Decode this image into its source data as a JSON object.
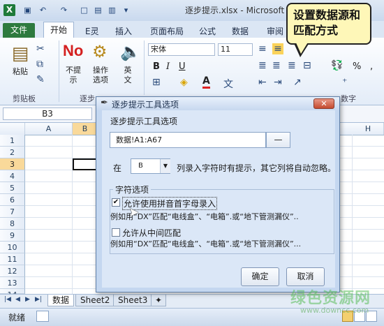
{
  "window": {
    "title": "逐步提示.xlsx - Microsoft Excel",
    "app_icon": "X"
  },
  "ribbon": {
    "tabs": [
      "文件",
      "开始",
      "E灵",
      "插入",
      "页面布局",
      "公式",
      "数据",
      "审阅"
    ],
    "clipboard": {
      "paste_label": "粘贴",
      "group_label": "剪贴板"
    },
    "prompt": {
      "no_prompt_label": "不提示",
      "ops_label": "操作选项",
      "en_label": "英文",
      "group_label": "逐步"
    },
    "font": {
      "name": "宋体",
      "size": "11"
    },
    "number": {
      "percent": "%",
      "group_label": "数字"
    }
  },
  "formula_bar": {
    "name_box": "B3"
  },
  "grid": {
    "columns": [
      "A",
      "B",
      "H"
    ],
    "rows": [
      "1",
      "2",
      "3",
      "4",
      "5",
      "6",
      "7",
      "8",
      "9",
      "10",
      "11",
      "12",
      "13",
      "14"
    ],
    "selected_row": "3"
  },
  "sheets": [
    "数据",
    "Sheet2",
    "Sheet3"
  ],
  "status": {
    "text": "就绪"
  },
  "callout": {
    "text": "设置数据源和匹配方式"
  },
  "dialog": {
    "title": "逐步提示工具选项",
    "source_label": "逐步提示工具选项",
    "source_value": "数据!A1:A67",
    "source_btn": "—",
    "col_prefix": "在",
    "col_value": "B",
    "col_suffix": "列录入字符时有提示，其它列将自动忽略。",
    "legend": "字符选项",
    "opt1": {
      "label": "允许使用拼音首字母录入",
      "checked": true,
      "example": "例如用“DX”匹配“电线盒”、“电箱”.或“地下管测漏仪”.."
    },
    "opt2": {
      "label": "允许从中间匹配",
      "checked": false,
      "example": "例如用“DX”匹配“电线盒”、“电箱”.或“地下管测漏仪”..."
    },
    "ok": "确定",
    "cancel": "取消"
  },
  "watermark": {
    "text": "绿色资源网",
    "url": "www.downcc.com"
  }
}
